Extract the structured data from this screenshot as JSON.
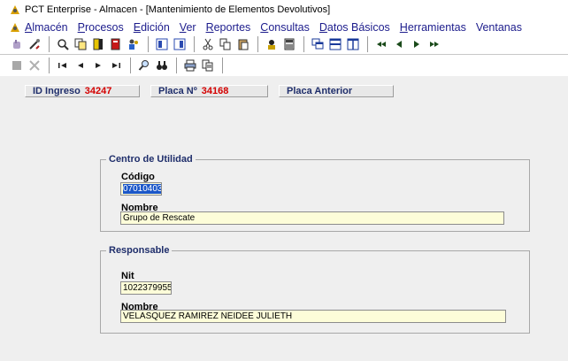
{
  "window": {
    "title": "PCT Enterprise - Almacen - [Mantenimiento de Elementos Devolutivos]"
  },
  "menu": [
    {
      "u": "A",
      "rest": "lmacén"
    },
    {
      "u": "P",
      "rest": "rocesos"
    },
    {
      "u": "E",
      "rest": "dición"
    },
    {
      "u": "V",
      "rest": "er"
    },
    {
      "u": "R",
      "rest": "eportes"
    },
    {
      "u": "C",
      "rest": "onsultas"
    },
    {
      "u": "D",
      "rest": "atos Básicos"
    },
    {
      "u": "H",
      "rest": "erramientas"
    },
    {
      "u": "",
      "rest": "Ventanas"
    }
  ],
  "header": {
    "id_ingreso_label": "ID Ingreso",
    "id_ingreso_value": "34247",
    "placa_label": "Placa Nº",
    "placa_value": "34168",
    "placa_anterior_label": "Placa Anterior"
  },
  "centro": {
    "legend": "Centro de Utilidad",
    "codigo_label": "Código",
    "codigo_value": "07010403",
    "nombre_label": "Nombre",
    "nombre_value": "Grupo de Rescate"
  },
  "responsable": {
    "legend": "Responsable",
    "nit_label": "Nit",
    "nit_value": "1022379955",
    "nombre_label": "Nombre",
    "nombre_value": "VELASQUEZ RAMIREZ NEIDEE JULIETH"
  }
}
